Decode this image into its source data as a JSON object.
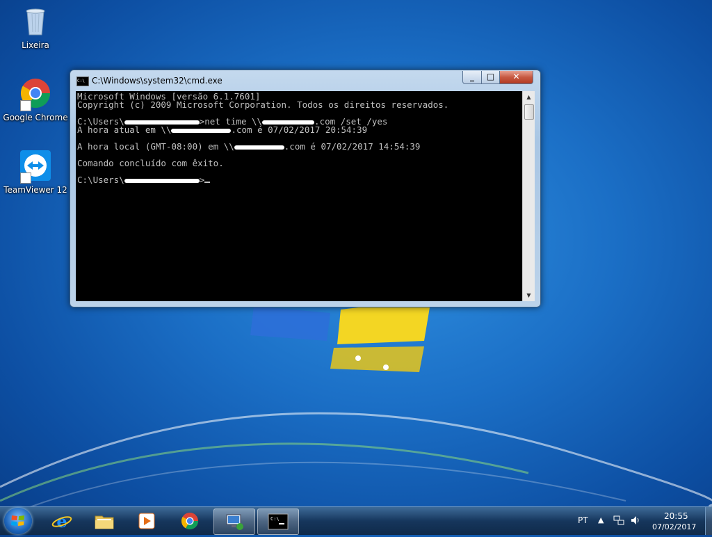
{
  "desktop": {
    "icons": [
      {
        "label": "Lixeira",
        "icon": "recycle-bin-icon"
      },
      {
        "label": "Google Chrome",
        "icon": "chrome-icon"
      },
      {
        "label": "TeamViewer 12",
        "icon": "teamviewer-icon"
      }
    ]
  },
  "window": {
    "title": "C:\\Windows\\system32\\cmd.exe",
    "controls": {
      "minimize": "minimize-icon",
      "maximize": "maximize-icon",
      "close": "close-icon"
    },
    "lines": {
      "l1": "Microsoft Windows [versão 6.1.7601]",
      "l2": "Copyright (c) 2009 Microsoft Corporation. Todos os direitos reservados.",
      "l4a": "C:\\Users\\",
      "l4b": ">net time \\\\",
      "l4c": ".com /set /yes",
      "l5a": "A hora atual em \\\\",
      "l5b": ".com é 07/02/2017 20:54:39",
      "l7a": "A hora local (GMT-08:00) em \\\\",
      "l7b": ".com é 07/02/2017 14:54:39",
      "l9": "Comando concluído com êxito.",
      "l11a": "C:\\Users\\",
      "l11b": ">"
    }
  },
  "taskbar": {
    "start": "windows-start-icon",
    "pinned": [
      {
        "name": "internet-explorer",
        "icon": "internet-explorer-icon"
      },
      {
        "name": "windows-explorer",
        "icon": "folder-icon"
      },
      {
        "name": "media-player",
        "icon": "media-player-icon"
      },
      {
        "name": "chrome",
        "icon": "chrome-icon"
      },
      {
        "name": "remote-desktop",
        "icon": "remote-desktop-icon"
      },
      {
        "name": "cmd",
        "icon": "cmd-icon"
      }
    ],
    "tray": {
      "language": "PT",
      "time": "20:55",
      "date": "07/02/2017"
    }
  }
}
